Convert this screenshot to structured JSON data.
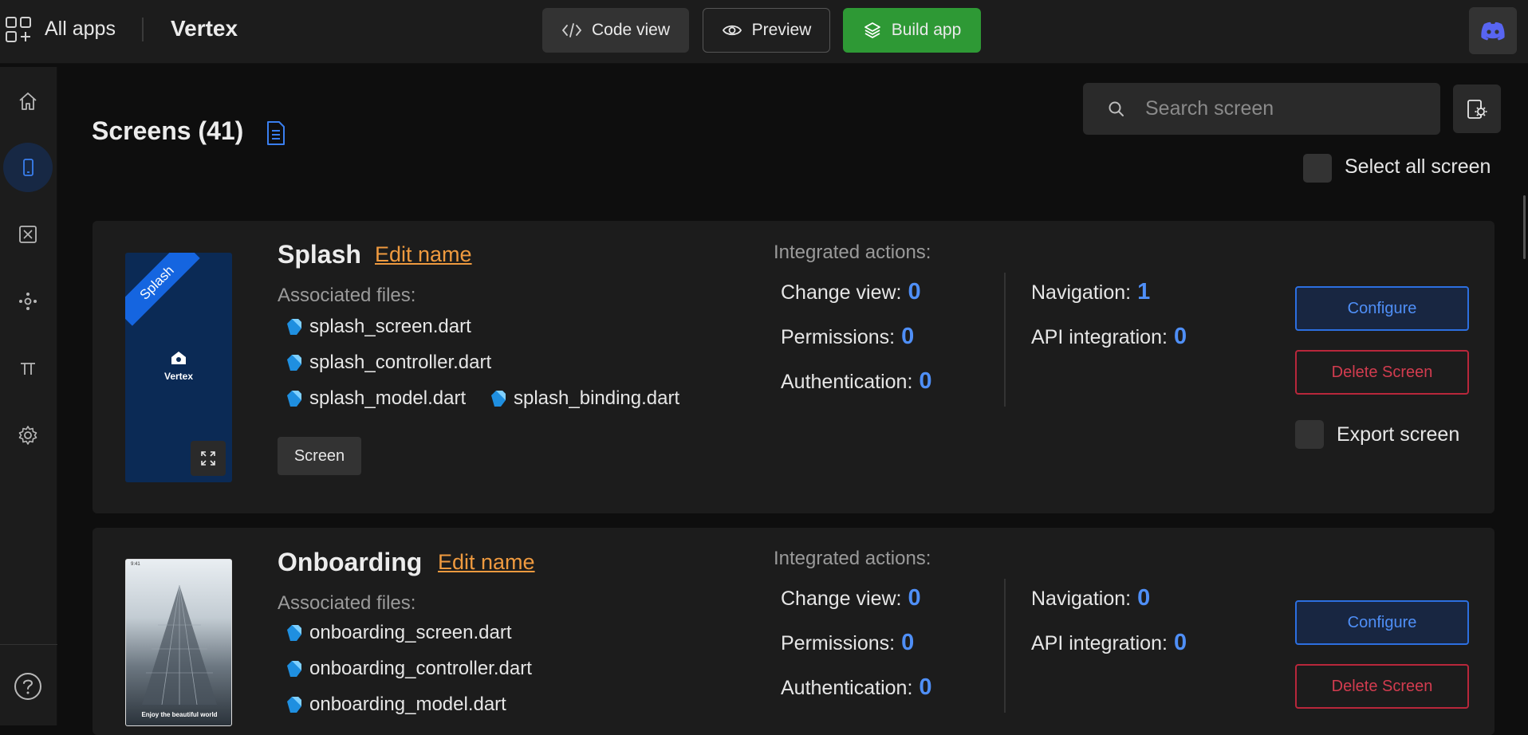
{
  "header": {
    "all_apps_label": "All apps",
    "app_name": "Vertex",
    "code_view_label": "Code view",
    "preview_label": "Preview",
    "build_app_label": "Build app",
    "build_color": "#2e9935"
  },
  "sidebar": {
    "items": [
      {
        "icon": "home-icon"
      },
      {
        "icon": "mobile-icon",
        "active": true
      },
      {
        "icon": "function-icon"
      },
      {
        "icon": "nodes-icon"
      },
      {
        "icon": "pi-icon"
      },
      {
        "icon": "gear-icon"
      },
      {
        "icon": "help-icon"
      }
    ]
  },
  "main": {
    "title": "Screens (41)",
    "search_placeholder": "Search screen",
    "select_all_label": "Select all screen"
  },
  "screens": [
    {
      "name": "Splash",
      "edit_label": "Edit name",
      "ribbon": "Splash",
      "thumb_brand": "Vertex",
      "assoc_label": "Associated files:",
      "files": [
        "splash_screen.dart",
        "splash_controller.dart",
        "splash_model.dart",
        "splash_binding.dart"
      ],
      "tag": "Screen",
      "integrated_label": "Integrated actions:",
      "stats": {
        "change_view": {
          "label": "Change view:",
          "value": "0"
        },
        "permissions": {
          "label": "Permissions:",
          "value": "0"
        },
        "authentication": {
          "label": "Authentication:",
          "value": "0"
        },
        "navigation": {
          "label": "Navigation:",
          "value": "1"
        },
        "api_integration": {
          "label": "API integration:",
          "value": "0"
        }
      },
      "configure_label": "Configure",
      "delete_label": "Delete Screen",
      "export_label": "Export screen"
    },
    {
      "name": "Onboarding",
      "edit_label": "Edit name",
      "thumb_time": "9:41",
      "thumb_caption": "Enjoy the beautiful world",
      "assoc_label": "Associated files:",
      "files": [
        "onboarding_screen.dart",
        "onboarding_controller.dart",
        "onboarding_model.dart"
      ],
      "integrated_label": "Integrated actions:",
      "stats": {
        "change_view": {
          "label": "Change view:",
          "value": "0"
        },
        "permissions": {
          "label": "Permissions:",
          "value": "0"
        },
        "authentication": {
          "label": "Authentication:",
          "value": "0"
        },
        "navigation": {
          "label": "Navigation:",
          "value": "0"
        },
        "api_integration": {
          "label": "API integration:",
          "value": "0"
        }
      },
      "configure_label": "Configure",
      "delete_label": "Delete Screen"
    }
  ],
  "colors": {
    "accent_blue": "#4f8ff7",
    "link_orange": "#ef9a3f",
    "danger_red": "#d23c4f"
  }
}
